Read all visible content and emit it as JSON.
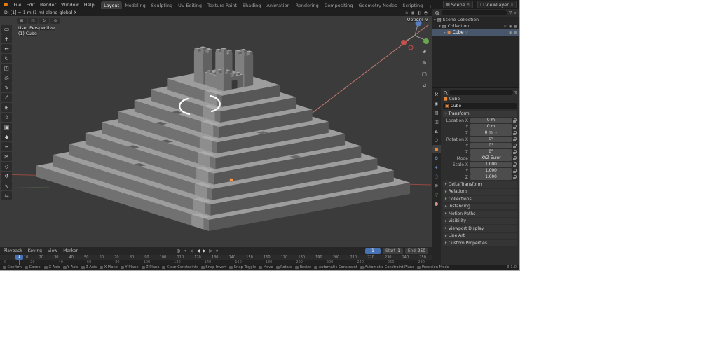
{
  "colors": {
    "accent": "#4772b3",
    "object_orange": "#e8883a",
    "data_green": "#74b374",
    "axis_red": "#9e4a43"
  },
  "topbar": {
    "menus": [
      "File",
      "Edit",
      "Render",
      "Window",
      "Help"
    ],
    "workspaces": [
      {
        "label": "Layout",
        "active": true
      },
      {
        "label": "Modeling"
      },
      {
        "label": "Sculpting"
      },
      {
        "label": "UV Editing"
      },
      {
        "label": "Texture Paint"
      },
      {
        "label": "Shading"
      },
      {
        "label": "Animation"
      },
      {
        "label": "Rendering"
      },
      {
        "label": "Compositing"
      },
      {
        "label": "Geometry Nodes"
      },
      {
        "label": "Scripting"
      }
    ],
    "add_workspace": "+",
    "scene_label": "Scene",
    "viewlayer_label": "ViewLayer"
  },
  "viewport_header": {
    "status_text": "D: [1] = 1 m (1 m) along global X",
    "icons": [
      {
        "name": "snap-magnet-icon",
        "glyph": "∩"
      },
      {
        "name": "proportional-edit-icon",
        "glyph": "◉"
      },
      {
        "name": "overlays-icon",
        "glyph": "◐"
      },
      {
        "name": "shading-mode-icon",
        "glyph": "◓"
      }
    ]
  },
  "viewport": {
    "options_label": "Options ∨",
    "overlay_line1": "User Perspective",
    "overlay_line2": "(1) Cube",
    "toolbar": [
      {
        "name": "select-box-tool-icon",
        "glyph": "▭"
      },
      {
        "name": "cursor-tool-icon",
        "glyph": "+"
      },
      {
        "name": "move-tool-icon",
        "glyph": "↔"
      },
      {
        "name": "rotate-tool-icon",
        "glyph": "↻"
      },
      {
        "name": "scale-tool-icon",
        "glyph": "◰"
      },
      {
        "name": "transform-tool-icon",
        "glyph": "◎"
      },
      {
        "name": "annotate-tool-icon",
        "glyph": "✎"
      },
      {
        "name": "measure-tool-icon",
        "glyph": "∠"
      },
      {
        "name": "add-cube-tool-icon",
        "glyph": "⊞"
      },
      {
        "name": "extrude-tool-icon",
        "glyph": "⇧"
      },
      {
        "name": "inset-faces-tool-icon",
        "glyph": "▣"
      },
      {
        "name": "bevel-tool-icon",
        "glyph": "◆"
      },
      {
        "name": "loop-cut-tool-icon",
        "glyph": "≡"
      },
      {
        "name": "knife-tool-icon",
        "glyph": "✂"
      },
      {
        "name": "poly-build-tool-icon",
        "glyph": "◇"
      },
      {
        "name": "spin-tool-icon",
        "glyph": "↺"
      },
      {
        "name": "smooth-tool-icon",
        "glyph": "∿"
      },
      {
        "name": "edge-slide-tool-icon",
        "glyph": "⇆"
      }
    ],
    "corner_icons": [
      {
        "name": "editor-type-icon",
        "glyph": "⊞"
      },
      {
        "name": "mode-toggle-icon",
        "glyph": "◫"
      },
      {
        "name": "view-rotate-icon",
        "glyph": "↻"
      },
      {
        "name": "pivot-icon",
        "glyph": "⊙"
      }
    ],
    "view_icons": [
      {
        "name": "zoom-icon",
        "glyph": "⊕"
      },
      {
        "name": "pan-hand-icon",
        "glyph": "⊜"
      },
      {
        "name": "camera-view-icon",
        "glyph": "▢"
      },
      {
        "name": "perspective-toggle-icon",
        "glyph": "⊿"
      }
    ]
  },
  "outliner": {
    "scene_collection": "Scene Collection",
    "collection": "Collection",
    "object": "Cube"
  },
  "properties": {
    "breadcrumb": "Cube",
    "name_value": "Cube",
    "transform_title": "Transform",
    "tabs": [
      {
        "name": "tool-tab-icon",
        "glyph": "⚒",
        "color": "#b9b9b9"
      },
      {
        "name": "render-tab-icon",
        "glyph": "◉",
        "color": "#b9b9b9"
      },
      {
        "name": "output-tab-icon",
        "glyph": "▤",
        "color": "#b9b9b9"
      },
      {
        "name": "view-layer-tab-icon",
        "glyph": "◫",
        "color": "#b9b9b9"
      },
      {
        "name": "scene-tab-icon",
        "glyph": "◭",
        "color": "#b9b9b9"
      },
      {
        "name": "world-tab-icon",
        "glyph": "○",
        "color": "#b9b9b9"
      },
      {
        "name": "object-tab-icon",
        "glyph": "■",
        "color": "#e8883a",
        "active": true
      },
      {
        "name": "modifiers-tab-icon",
        "glyph": "⚙",
        "color": "#6f9fd3"
      },
      {
        "name": "particles-tab-icon",
        "glyph": "∗",
        "color": "#6f9fd3"
      },
      {
        "name": "physics-tab-icon",
        "glyph": "◌",
        "color": "#6f9fd3"
      },
      {
        "name": "constraints-tab-icon",
        "glyph": "⊗",
        "color": "#b9b9b9"
      },
      {
        "name": "object-data-tab-icon",
        "glyph": "▽",
        "color": "#74b374"
      },
      {
        "name": "material-tab-icon",
        "glyph": "●",
        "color": "#cf8f8f"
      }
    ],
    "transform_rows": [
      {
        "label": "Location X",
        "value": "0 m"
      },
      {
        "label": "Y",
        "value": "0 m"
      },
      {
        "label": "Z",
        "value": "0 m"
      },
      {
        "label": "Rotation X",
        "value": "0°"
      },
      {
        "label": "Y",
        "value": "0°"
      },
      {
        "label": "Z",
        "value": "0°"
      },
      {
        "label": "Mode",
        "value": "XYZ Euler"
      },
      {
        "label": "Scale X",
        "value": "1.000"
      },
      {
        "label": "Y",
        "value": "1.000"
      },
      {
        "label": "Z",
        "value": "1.000"
      }
    ],
    "sections": [
      "Delta Transform",
      "Relations",
      "Collections",
      "Instancing",
      "Motion Paths",
      "Visibility",
      "Viewport Display",
      "Line Art",
      "Custom Properties"
    ]
  },
  "timeline": {
    "menus": [
      "Playback",
      "Keying",
      "View",
      "Marker"
    ],
    "transport": [
      {
        "name": "jump-to-start-icon",
        "glyph": "«"
      },
      {
        "name": "prev-keyframe-icon",
        "glyph": "◁"
      },
      {
        "name": "play-reverse-icon",
        "glyph": "◀"
      },
      {
        "name": "play-icon",
        "glyph": "▶"
      },
      {
        "name": "next-keyframe-icon",
        "glyph": "▷"
      },
      {
        "name": "jump-to-end-icon",
        "glyph": "»"
      }
    ],
    "current_frame": "1",
    "start_label": "Start",
    "start_value": "1",
    "end_label": "End",
    "end_value": "250",
    "playhead_label": "1",
    "ruler_major": [
      "10",
      "20",
      "30",
      "40",
      "50",
      "60",
      "70",
      "80",
      "90",
      "100",
      "110",
      "120",
      "130",
      "140",
      "150",
      "160",
      "170",
      "180",
      "190",
      "200",
      "210",
      "220",
      "230",
      "240",
      "250"
    ],
    "ruler_minor": [
      "0",
      "20",
      "40",
      "60",
      "80",
      "100",
      "120",
      "140",
      "160",
      "180",
      "200",
      "220",
      "240",
      "260",
      "280"
    ]
  },
  "statusbar": {
    "hints": [
      "Confirm",
      "Cancel",
      "X Axis",
      "Y Axis",
      "Z Axis",
      "X Plane",
      "Y Plane",
      "Z Plane",
      "Clear Constraints",
      "Snap Invert",
      "Snap Toggle",
      "Move",
      "Rotate",
      "Resize",
      "Automatic Constraint",
      "Automatic Constraint Plane",
      "Precision Mode"
    ],
    "version": "3.1.0"
  }
}
